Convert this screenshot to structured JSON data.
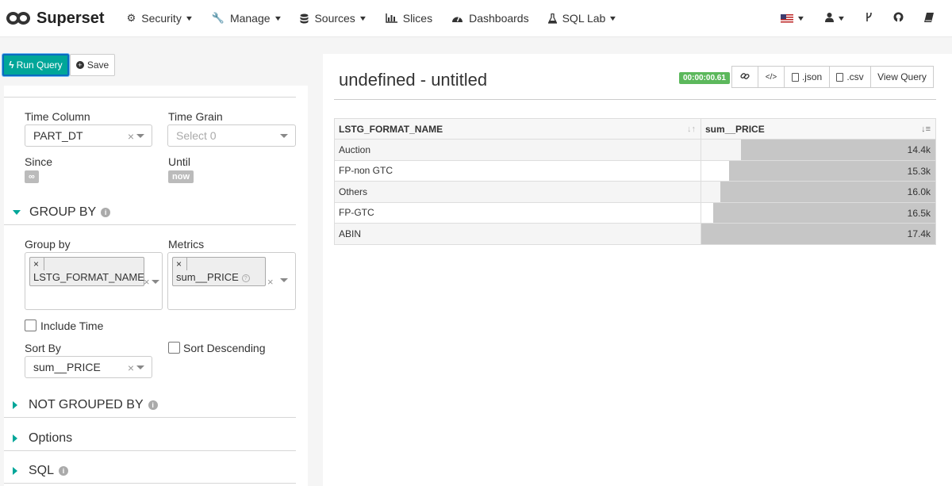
{
  "app": {
    "name": "Superset"
  },
  "nav": {
    "items": [
      {
        "label": "Security",
        "icon": "gears-icon"
      },
      {
        "label": "Manage",
        "icon": "wrench-icon"
      },
      {
        "label": "Sources",
        "icon": "database-icon"
      },
      {
        "label": "Slices",
        "icon": "bar-chart-icon"
      },
      {
        "label": "Dashboards",
        "icon": "dashboard-icon"
      },
      {
        "label": "SQL Lab",
        "icon": "flask-icon"
      }
    ],
    "right_icons": [
      "us-flag-icon",
      "user-icon",
      "code-fork-icon",
      "github-icon",
      "book-icon"
    ]
  },
  "toolbar": {
    "run_label": "Run Query",
    "save_label": "Save"
  },
  "controls": {
    "time_column": {
      "label": "Time Column",
      "value": "PART_DT"
    },
    "time_grain": {
      "label": "Time Grain",
      "placeholder": "Select 0"
    },
    "since": {
      "label": "Since",
      "value": "∞"
    },
    "until": {
      "label": "Until",
      "value": "now"
    },
    "group_by_section": "GROUP BY",
    "group_by": {
      "label": "Group by",
      "value": "LSTG_FORMAT_NAME"
    },
    "metrics": {
      "label": "Metrics",
      "value": "sum__PRICE"
    },
    "include_time": {
      "label": "Include Time",
      "checked": false
    },
    "sort_by": {
      "label": "Sort By",
      "value": "sum__PRICE"
    },
    "sort_descending": {
      "label": "Sort Descending",
      "checked": false
    },
    "not_grouped_section": "NOT GROUPED BY",
    "options_section": "Options",
    "sql_section": "SQL"
  },
  "chart": {
    "title": "undefined - untitled",
    "timer": "00:00:00.61",
    "actions": [
      ".json",
      ".csv",
      "View Query"
    ]
  },
  "table": {
    "columns": [
      "LSTG_FORMAT_NAME",
      "sum__PRICE"
    ],
    "rows": [
      {
        "name": "Auction",
        "value": "14.4k"
      },
      {
        "name": "FP-non GTC",
        "value": "15.3k"
      },
      {
        "name": "Others",
        "value": "16.0k"
      },
      {
        "name": "FP-GTC",
        "value": "16.5k"
      },
      {
        "name": "ABIN",
        "value": "17.4k"
      }
    ],
    "bar_fractions": [
      0.83,
      0.88,
      0.92,
      0.95,
      1.0
    ]
  }
}
